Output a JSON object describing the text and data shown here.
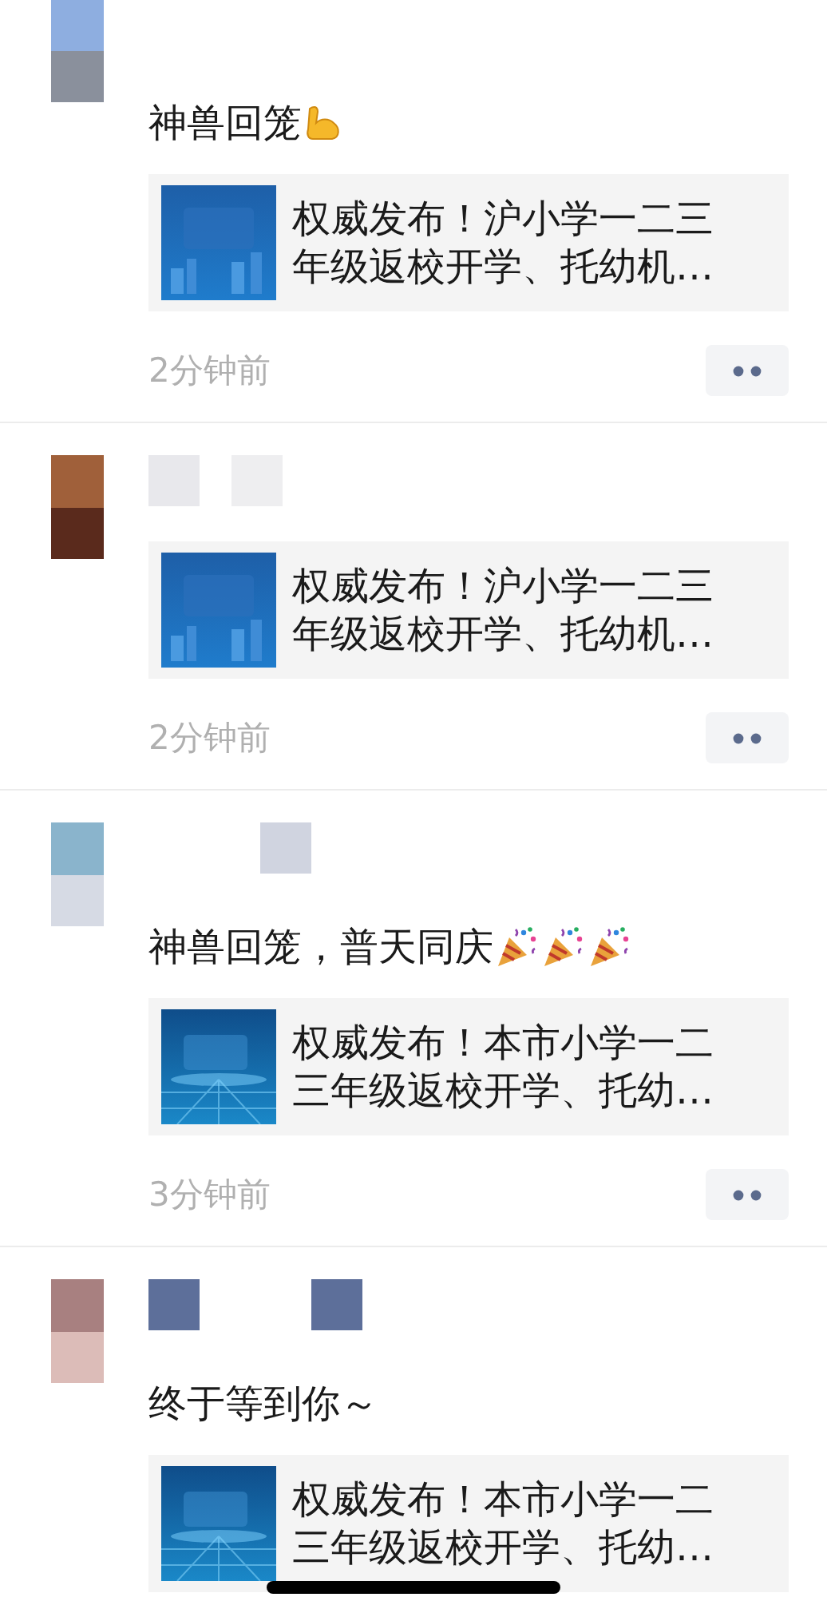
{
  "posts": [
    {
      "comment": "神兽回笼",
      "emoji": [
        {
          "kind": "muscle"
        }
      ],
      "link": {
        "lines": [
          "权威发布！沪小学一二三",
          "年级返校开学、托幼机…"
        ]
      },
      "time": "2分钟前"
    },
    {
      "link": {
        "lines": [
          "权威发布！沪小学一二三",
          "年级返校开学、托幼机…"
        ]
      },
      "time": "2分钟前"
    },
    {
      "comment": "神兽回笼，普天同庆",
      "emoji": [
        {
          "kind": "party-popper"
        },
        {
          "kind": "party-popper"
        },
        {
          "kind": "party-popper"
        }
      ],
      "link": {
        "lines": [
          "权威发布！本市小学一二",
          "三年级返校开学、托幼…"
        ]
      },
      "time": "3分钟前"
    },
    {
      "comment": "终于等到你～",
      "link": {
        "lines": [
          "权威发布！本市小学一二",
          "三年级返校开学、托幼…"
        ]
      }
    }
  ]
}
